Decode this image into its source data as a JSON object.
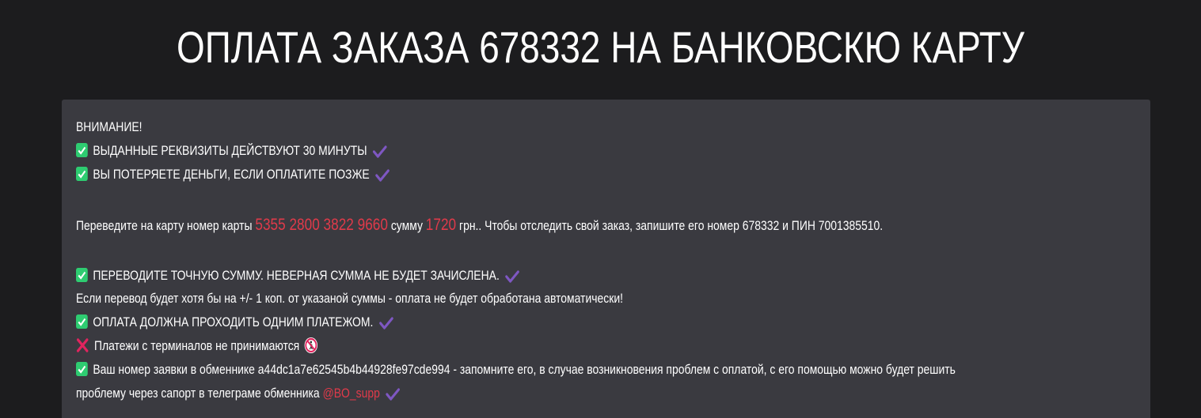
{
  "header": {
    "title": "ОПЛАТА ЗАКАЗА 678332 НА БАНКОВСКЮ КАРТУ"
  },
  "notice": {
    "attention": "ВНИМАНИЕ!",
    "item1": "ВЫДАННЫЕ РЕКВИЗИТЫ ДЕЙСТВУЮТ 30 МИНУТЫ",
    "item2": "ВЫ ПОТЕРЯЕТЕ ДЕНЬГИ, ЕСЛИ ОПЛАТИТЕ ПОЗЖЕ"
  },
  "transfer": {
    "prefix": "Переведите на карту номер карты",
    "card_number": "5355 2800 3822 9660",
    "sum_label": "сумму",
    "amount": "1720",
    "suffix": "грн.. Чтобы отследить свой заказ, запишите его номер 678332 и ПИН 7001385510."
  },
  "rules": {
    "exact_sum": "ПЕРЕВОДИТЕ ТОЧНУЮ СУММУ. НЕВЕРНАЯ СУММА НЕ БУДЕТ ЗАЧИСЛЕНА.",
    "exact_sum_note": "Если перевод будет хотя бы на +/- 1 коп. от указаной суммы - оплата не будет обработана автоматически!",
    "single_payment": "ОПЛАТА ДОЛЖНА ПРОХОДИТЬ ОДНИМ ПЛАТЕЖОМ.",
    "no_terminals": "Платежи с терминалов не принимаются",
    "request_number_line1": "Ваш номер заявки в обменнике a44dc1a7e62545b4b44928fe97cde994 - запомните его, в случае возникновения проблем с оплатой, с его помощью можно будет решить",
    "request_number_line2": "проблему через сапорт в телеграме обменника",
    "support_handle": "@BO_supp"
  },
  "colors": {
    "background": "#1c1c1e",
    "panel": "#3a3a40",
    "highlight": "#e03a4a",
    "check_green": "#2ecc71",
    "tick_purple": "#7e57c2",
    "cross_red": "#e0245e"
  },
  "icons": {
    "check": "white-heavy-check-mark-icon",
    "tick": "heavy-check-mark-icon",
    "cross": "cross-mark-icon",
    "no_entry": "no-pedestrians-icon"
  }
}
